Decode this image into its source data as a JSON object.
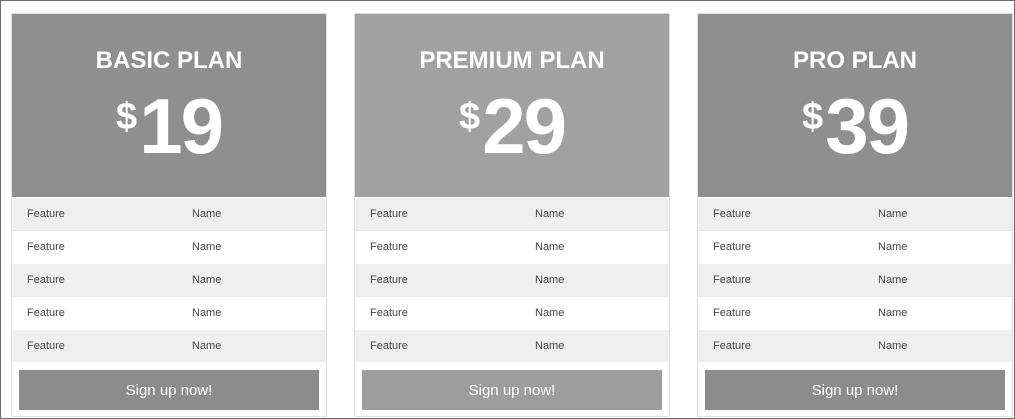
{
  "plans": [
    {
      "name": "BASIC PLAN",
      "currency": "$",
      "price": "19",
      "header_color": "#8f8f8f",
      "button_color": "#8c8c8c",
      "features": [
        {
          "feature": "Feature",
          "name": "Name"
        },
        {
          "feature": "Feature",
          "name": "Name"
        },
        {
          "feature": "Feature",
          "name": "Name"
        },
        {
          "feature": "Feature",
          "name": "Name"
        },
        {
          "feature": "Feature",
          "name": "Name"
        }
      ],
      "cta": "Sign up now!"
    },
    {
      "name": "PREMIUM PLAN",
      "currency": "$",
      "price": "29",
      "header_color": "#a1a1a1",
      "button_color": "#9d9d9d",
      "features": [
        {
          "feature": "Feature",
          "name": "Name"
        },
        {
          "feature": "Feature",
          "name": "Name"
        },
        {
          "feature": "Feature",
          "name": "Name"
        },
        {
          "feature": "Feature",
          "name": "Name"
        },
        {
          "feature": "Feature",
          "name": "Name"
        }
      ],
      "cta": "Sign up now!"
    },
    {
      "name": "PRO PLAN",
      "currency": "$",
      "price": "39",
      "header_color": "#8f8f8f",
      "button_color": "#8c8c8c",
      "features": [
        {
          "feature": "Feature",
          "name": "Name"
        },
        {
          "feature": "Feature",
          "name": "Name"
        },
        {
          "feature": "Feature",
          "name": "Name"
        },
        {
          "feature": "Feature",
          "name": "Name"
        },
        {
          "feature": "Feature",
          "name": "Name"
        }
      ],
      "cta": "Sign up now!"
    }
  ]
}
